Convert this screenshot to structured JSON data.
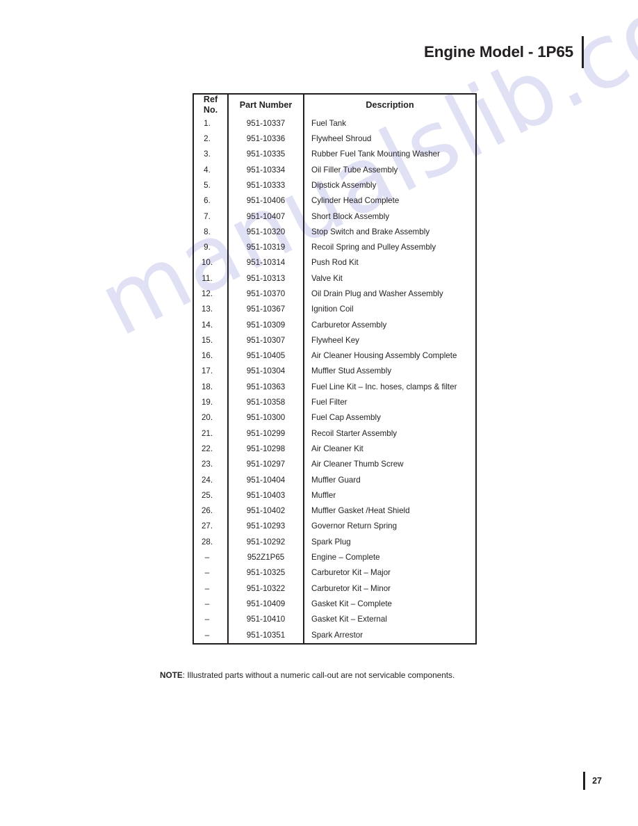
{
  "document": {
    "watermark_text": "manualslib.com",
    "watermark_color": "#c7c9ee",
    "ink_color": "#231f20"
  },
  "header": {
    "title": "Engine Model - 1P65"
  },
  "table": {
    "columns": [
      "Ref No.",
      "Part Number",
      "Description"
    ],
    "column_ref_line1": "Ref",
    "column_ref_line2": "No.",
    "column_part": "Part Number",
    "column_desc": "Description",
    "rows": [
      {
        "ref": "1.",
        "part": "951-10337",
        "desc": "Fuel Tank"
      },
      {
        "ref": "2.",
        "part": "951-10336",
        "desc": "Flywheel Shroud"
      },
      {
        "ref": "3.",
        "part": "951-10335",
        "desc": "Rubber Fuel Tank Mounting Washer"
      },
      {
        "ref": "4.",
        "part": "951-10334",
        "desc": "Oil Filler Tube Assembly"
      },
      {
        "ref": "5.",
        "part": "951-10333",
        "desc": "Dipstick Assembly"
      },
      {
        "ref": "6.",
        "part": "951-10406",
        "desc": "Cylinder Head Complete"
      },
      {
        "ref": "7.",
        "part": "951-10407",
        "desc": "Short Block Assembly"
      },
      {
        "ref": "8.",
        "part": "951-10320",
        "desc": "Stop Switch and Brake Assembly"
      },
      {
        "ref": "9.",
        "part": "951-10319",
        "desc": "Recoil Spring and Pulley Assembly"
      },
      {
        "ref": "10.",
        "part": "951-10314",
        "desc": "Push Rod Kit"
      },
      {
        "ref": "11.",
        "part": "951-10313",
        "desc": "Valve Kit"
      },
      {
        "ref": "12.",
        "part": "951-10370",
        "desc": "Oil Drain Plug and Washer Assembly"
      },
      {
        "ref": "13.",
        "part": "951-10367",
        "desc": "Ignition Coil"
      },
      {
        "ref": "14.",
        "part": "951-10309",
        "desc": "Carburetor Assembly"
      },
      {
        "ref": "15.",
        "part": "951-10307",
        "desc": "Flywheel Key"
      },
      {
        "ref": "16.",
        "part": "951-10405",
        "desc": "Air Cleaner Housing Assembly Complete"
      },
      {
        "ref": "17.",
        "part": "951-10304",
        "desc": "Muffler Stud Assembly"
      },
      {
        "ref": "18.",
        "part": "951-10363",
        "desc": "Fuel Line Kit – Inc. hoses, clamps & filter"
      },
      {
        "ref": "19.",
        "part": "951-10358",
        "desc": "Fuel Filter"
      },
      {
        "ref": "20.",
        "part": "951-10300",
        "desc": "Fuel Cap Assembly"
      },
      {
        "ref": "21.",
        "part": "951-10299",
        "desc": "Recoil Starter Assembly"
      },
      {
        "ref": "22.",
        "part": "951-10298",
        "desc": "Air Cleaner Kit"
      },
      {
        "ref": "23.",
        "part": "951-10297",
        "desc": "Air Cleaner Thumb Screw"
      },
      {
        "ref": "24.",
        "part": "951-10404",
        "desc": "Muffler Guard"
      },
      {
        "ref": "25.",
        "part": "951-10403",
        "desc": "Muffler"
      },
      {
        "ref": "26.",
        "part": "951-10402",
        "desc": "Muffler Gasket /Heat Shield"
      },
      {
        "ref": "27.",
        "part": "951-10293",
        "desc": "Governor Return Spring"
      },
      {
        "ref": "28.",
        "part": "951-10292",
        "desc": "Spark Plug"
      },
      {
        "ref": "–",
        "part": "952Z1P65",
        "desc": "Engine – Complete"
      },
      {
        "ref": "–",
        "part": "951-10325",
        "desc": "Carburetor Kit – Major"
      },
      {
        "ref": "–",
        "part": "951-10322",
        "desc": "Carburetor Kit – Minor"
      },
      {
        "ref": "–",
        "part": "951-10409",
        "desc": "Gasket Kit – Complete"
      },
      {
        "ref": "–",
        "part": "951-10410",
        "desc": "Gasket Kit – External"
      },
      {
        "ref": "–",
        "part": "951-10351",
        "desc": "Spark Arrestor"
      }
    ]
  },
  "note": {
    "label": "NOTE",
    "text": ": Illustrated parts without a numeric call-out are not servicable components."
  },
  "footer": {
    "page_number": "27"
  }
}
